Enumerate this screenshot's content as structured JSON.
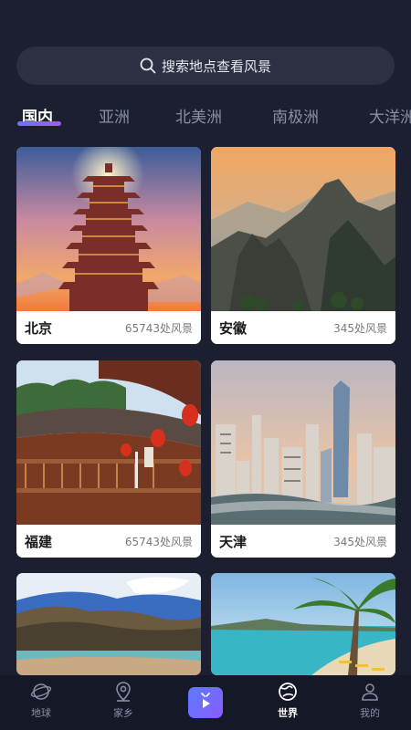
{
  "search": {
    "placeholder": "搜索地点查看风景"
  },
  "tabs": [
    {
      "label": "国内"
    },
    {
      "label": "亚洲"
    },
    {
      "label": "北美洲"
    },
    {
      "label": "南极洲"
    },
    {
      "label": "大洋洲"
    }
  ],
  "cards": [
    {
      "name": "北京",
      "count": "65743处风景",
      "image": "pagoda-sunset"
    },
    {
      "name": "安徽",
      "count": "345处风景",
      "image": "mountain-peaks"
    },
    {
      "name": "福建",
      "count": "65743处风景",
      "image": "tulou-building"
    },
    {
      "name": "天津",
      "count": "345处风景",
      "image": "city-skyline"
    },
    {
      "name": "",
      "count": "",
      "image": "mountain-lake"
    },
    {
      "name": "",
      "count": "",
      "image": "tropical-beach"
    }
  ],
  "nav": [
    {
      "label": "地球",
      "icon": "planet-icon"
    },
    {
      "label": "家乡",
      "icon": "location-pin-icon"
    },
    {
      "label": "",
      "icon": "play-tv-icon"
    },
    {
      "label": "世界",
      "icon": "globe-icon"
    },
    {
      "label": "我的",
      "icon": "person-icon"
    }
  ],
  "colors": {
    "background": "#1c1f30",
    "accent": "#7a66ff",
    "nav_bg": "#151827"
  }
}
